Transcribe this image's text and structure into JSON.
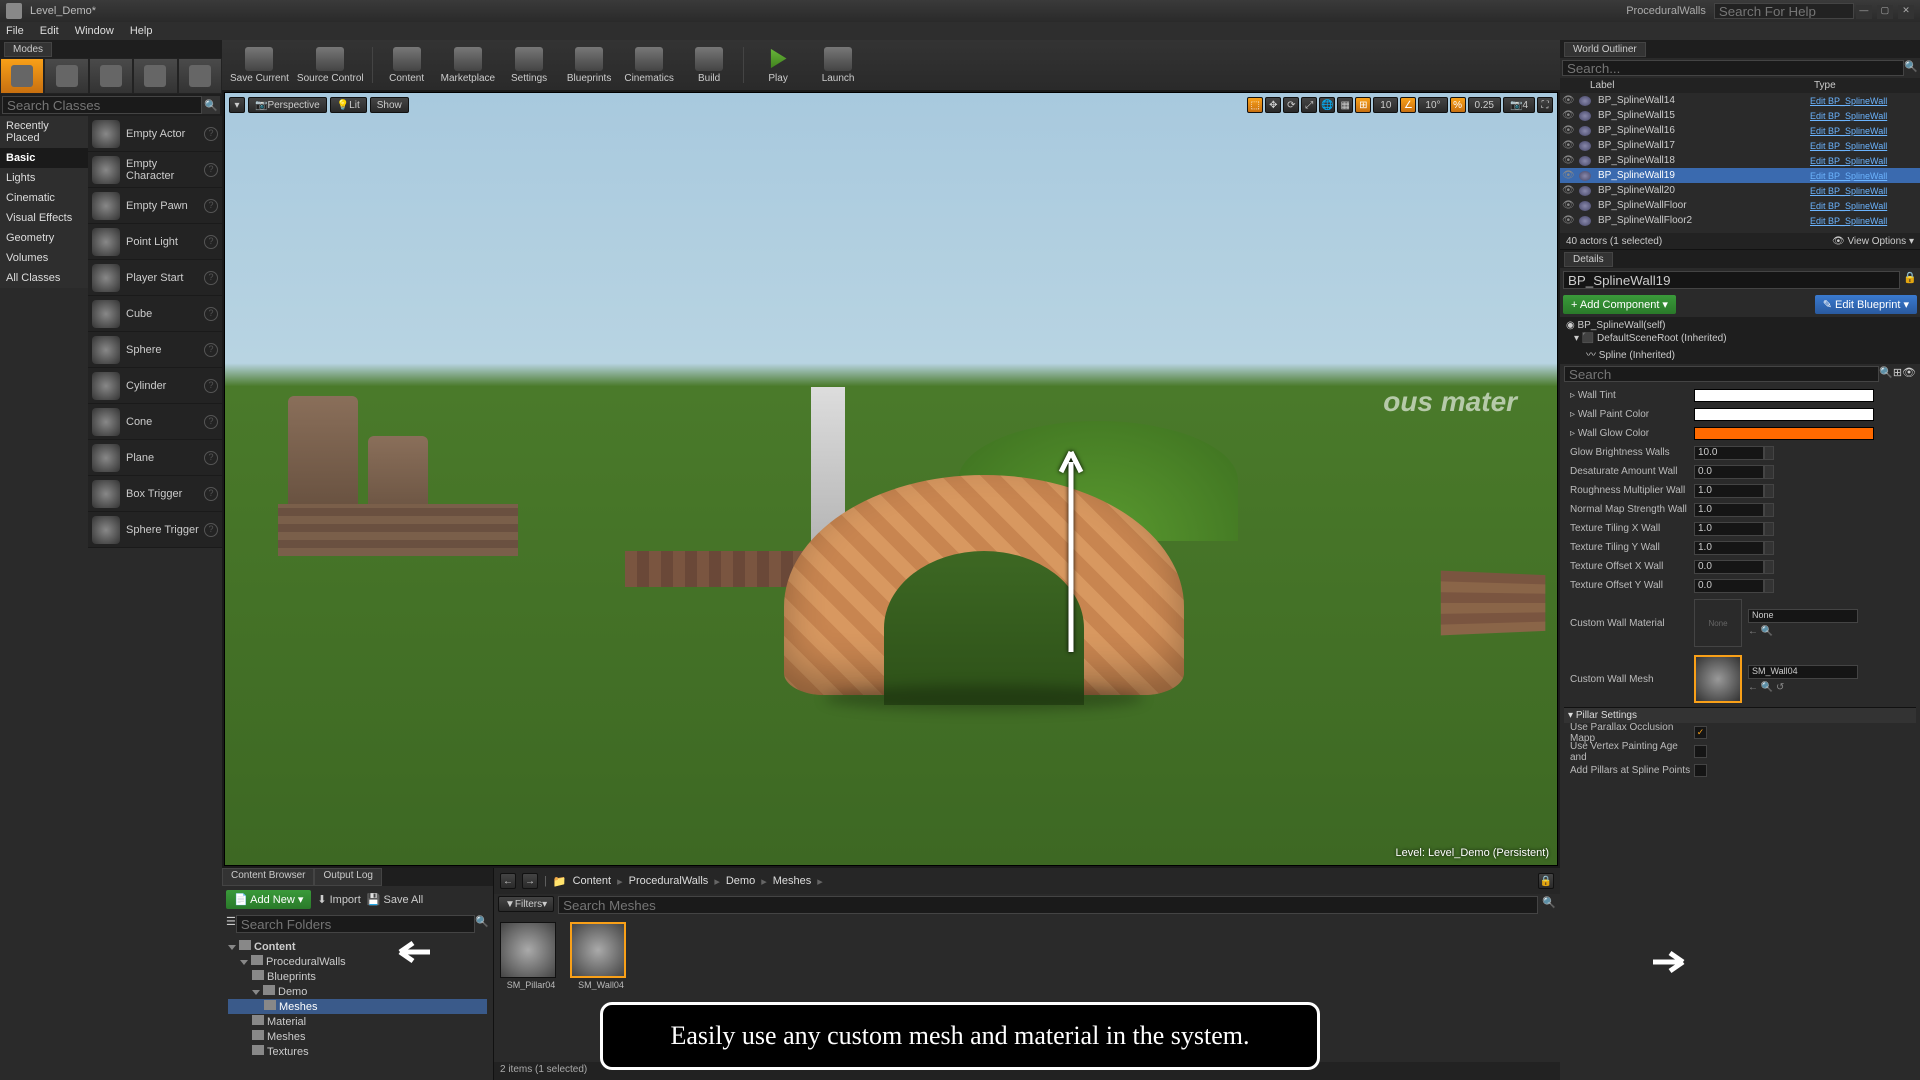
{
  "title": "Level_Demo*",
  "project": "ProceduralWalls",
  "search_help_placeholder": "Search For Help",
  "menu": {
    "file": "File",
    "edit": "Edit",
    "window": "Window",
    "help": "Help"
  },
  "modes": {
    "tab": "Modes",
    "search_placeholder": "Search Classes"
  },
  "categories": [
    "Recently Placed",
    "Basic",
    "Lights",
    "Cinematic",
    "Visual Effects",
    "Geometry",
    "Volumes",
    "All Classes"
  ],
  "actors": [
    "Empty Actor",
    "Empty Character",
    "Empty Pawn",
    "Point Light",
    "Player Start",
    "Cube",
    "Sphere",
    "Cylinder",
    "Cone",
    "Plane",
    "Box Trigger",
    "Sphere Trigger"
  ],
  "toolbar": {
    "save": "Save Current",
    "source": "Source Control",
    "content": "Content",
    "marketplace": "Marketplace",
    "settings": "Settings",
    "blueprints": "Blueprints",
    "cinematics": "Cinematics",
    "build": "Build",
    "play": "Play",
    "launch": "Launch"
  },
  "viewport": {
    "perspective": "Perspective",
    "lit": "Lit",
    "show": "Show",
    "snap1": "10",
    "snap2": "10°",
    "snap3": "0.25",
    "cam": "4",
    "level_label": "Level:  Level_Demo (Persistent)",
    "text3d": "ous mater"
  },
  "annotation": "Easily use any custom mesh and material in the system.",
  "outliner": {
    "tab": "World Outliner",
    "search_placeholder": "Search...",
    "col_label": "Label",
    "col_type": "Type",
    "rows": [
      {
        "name": "BP_SplineWall14",
        "type": "Edit BP_SplineWall"
      },
      {
        "name": "BP_SplineWall15",
        "type": "Edit BP_SplineWall"
      },
      {
        "name": "BP_SplineWall16",
        "type": "Edit BP_SplineWall"
      },
      {
        "name": "BP_SplineWall17",
        "type": "Edit BP_SplineWall"
      },
      {
        "name": "BP_SplineWall18",
        "type": "Edit BP_SplineWall"
      },
      {
        "name": "BP_SplineWall19",
        "type": "Edit BP_SplineWall",
        "sel": true
      },
      {
        "name": "BP_SplineWall20",
        "type": "Edit BP_SplineWall"
      },
      {
        "name": "BP_SplineWallFloor",
        "type": "Edit BP_SplineWall"
      },
      {
        "name": "BP_SplineWallFloor2",
        "type": "Edit BP_SplineWall"
      }
    ],
    "footer": "40 actors (1 selected)",
    "view_opts": "View Options"
  },
  "details": {
    "tab": "Details",
    "name": "BP_SplineWall19",
    "add_comp": "+ Add Component",
    "edit_bp": "Edit Blueprint",
    "comp_root": "BP_SplineWall(self)",
    "comp_scene": "DefaultSceneRoot (Inherited)",
    "comp_spline": "Spline (Inherited)",
    "search_placeholder": "Search",
    "props": {
      "wall_tint": "Wall Tint",
      "wall_paint": "Wall Paint Color",
      "wall_glow": "Wall Glow Color",
      "glow_bright": "Glow Brightness Walls",
      "glow_bright_v": "10.0",
      "desat": "Desaturate Amount Wall",
      "desat_v": "0.0",
      "rough": "Roughness Multiplier Wall",
      "rough_v": "1.0",
      "normal": "Normal Map Strength Wall",
      "normal_v": "1.0",
      "tilex": "Texture Tiling X Wall",
      "tilex_v": "1.0",
      "tiley": "Texture Tiling Y Wall",
      "tiley_v": "1.0",
      "offx": "Texture Offset X Wall",
      "offx_v": "0.0",
      "offy": "Texture Offset Y Wall",
      "offy_v": "0.0",
      "custom_mat": "Custom Wall Material",
      "custom_mat_v": "None",
      "custom_mesh": "Custom Wall Mesh",
      "custom_mesh_v": "SM_Wall04",
      "pillar_section": "Pillar Settings",
      "parallax": "Use Parallax Occlusion Mapp",
      "vertex": "Use Vertex Painting Age and",
      "add_pillars": "Add Pillars at Spline Points"
    }
  },
  "cb": {
    "tab1": "Content Browser",
    "tab2": "Output Log",
    "add_new": "Add New",
    "import": "Import",
    "save_all": "Save All",
    "search_folders": "Search Folders",
    "tree": {
      "content": "Content",
      "procwalls": "ProceduralWalls",
      "demo": "Demo",
      "blueprints": "Blueprints",
      "meshes": "Meshes",
      "material": "Material",
      "textures": "Textures"
    },
    "crumbs": [
      "Content",
      "ProceduralWalls",
      "Demo",
      "Meshes"
    ],
    "filters": "Filters",
    "search_meshes": "Search Meshes",
    "assets": [
      {
        "name": "SM_Pillar04"
      },
      {
        "name": "SM_Wall04",
        "sel": true
      }
    ],
    "status": "2 items (1 selected)"
  }
}
